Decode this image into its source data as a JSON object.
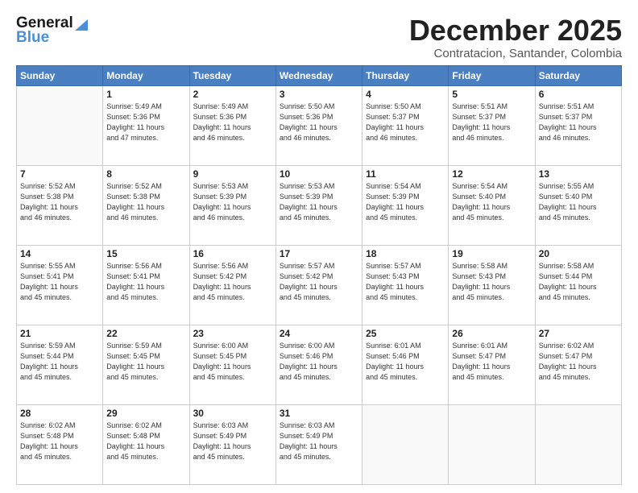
{
  "header": {
    "logo_line1": "General",
    "logo_line2": "Blue",
    "month": "December 2025",
    "location": "Contratacion, Santander, Colombia"
  },
  "weekdays": [
    "Sunday",
    "Monday",
    "Tuesday",
    "Wednesday",
    "Thursday",
    "Friday",
    "Saturday"
  ],
  "weeks": [
    [
      {
        "day": "",
        "info": ""
      },
      {
        "day": "1",
        "info": "Sunrise: 5:49 AM\nSunset: 5:36 PM\nDaylight: 11 hours\nand 47 minutes."
      },
      {
        "day": "2",
        "info": "Sunrise: 5:49 AM\nSunset: 5:36 PM\nDaylight: 11 hours\nand 46 minutes."
      },
      {
        "day": "3",
        "info": "Sunrise: 5:50 AM\nSunset: 5:36 PM\nDaylight: 11 hours\nand 46 minutes."
      },
      {
        "day": "4",
        "info": "Sunrise: 5:50 AM\nSunset: 5:37 PM\nDaylight: 11 hours\nand 46 minutes."
      },
      {
        "day": "5",
        "info": "Sunrise: 5:51 AM\nSunset: 5:37 PM\nDaylight: 11 hours\nand 46 minutes."
      },
      {
        "day": "6",
        "info": "Sunrise: 5:51 AM\nSunset: 5:37 PM\nDaylight: 11 hours\nand 46 minutes."
      }
    ],
    [
      {
        "day": "7",
        "info": "Sunrise: 5:52 AM\nSunset: 5:38 PM\nDaylight: 11 hours\nand 46 minutes."
      },
      {
        "day": "8",
        "info": "Sunrise: 5:52 AM\nSunset: 5:38 PM\nDaylight: 11 hours\nand 46 minutes."
      },
      {
        "day": "9",
        "info": "Sunrise: 5:53 AM\nSunset: 5:39 PM\nDaylight: 11 hours\nand 46 minutes."
      },
      {
        "day": "10",
        "info": "Sunrise: 5:53 AM\nSunset: 5:39 PM\nDaylight: 11 hours\nand 45 minutes."
      },
      {
        "day": "11",
        "info": "Sunrise: 5:54 AM\nSunset: 5:39 PM\nDaylight: 11 hours\nand 45 minutes."
      },
      {
        "day": "12",
        "info": "Sunrise: 5:54 AM\nSunset: 5:40 PM\nDaylight: 11 hours\nand 45 minutes."
      },
      {
        "day": "13",
        "info": "Sunrise: 5:55 AM\nSunset: 5:40 PM\nDaylight: 11 hours\nand 45 minutes."
      }
    ],
    [
      {
        "day": "14",
        "info": "Sunrise: 5:55 AM\nSunset: 5:41 PM\nDaylight: 11 hours\nand 45 minutes."
      },
      {
        "day": "15",
        "info": "Sunrise: 5:56 AM\nSunset: 5:41 PM\nDaylight: 11 hours\nand 45 minutes."
      },
      {
        "day": "16",
        "info": "Sunrise: 5:56 AM\nSunset: 5:42 PM\nDaylight: 11 hours\nand 45 minutes."
      },
      {
        "day": "17",
        "info": "Sunrise: 5:57 AM\nSunset: 5:42 PM\nDaylight: 11 hours\nand 45 minutes."
      },
      {
        "day": "18",
        "info": "Sunrise: 5:57 AM\nSunset: 5:43 PM\nDaylight: 11 hours\nand 45 minutes."
      },
      {
        "day": "19",
        "info": "Sunrise: 5:58 AM\nSunset: 5:43 PM\nDaylight: 11 hours\nand 45 minutes."
      },
      {
        "day": "20",
        "info": "Sunrise: 5:58 AM\nSunset: 5:44 PM\nDaylight: 11 hours\nand 45 minutes."
      }
    ],
    [
      {
        "day": "21",
        "info": "Sunrise: 5:59 AM\nSunset: 5:44 PM\nDaylight: 11 hours\nand 45 minutes."
      },
      {
        "day": "22",
        "info": "Sunrise: 5:59 AM\nSunset: 5:45 PM\nDaylight: 11 hours\nand 45 minutes."
      },
      {
        "day": "23",
        "info": "Sunrise: 6:00 AM\nSunset: 5:45 PM\nDaylight: 11 hours\nand 45 minutes."
      },
      {
        "day": "24",
        "info": "Sunrise: 6:00 AM\nSunset: 5:46 PM\nDaylight: 11 hours\nand 45 minutes."
      },
      {
        "day": "25",
        "info": "Sunrise: 6:01 AM\nSunset: 5:46 PM\nDaylight: 11 hours\nand 45 minutes."
      },
      {
        "day": "26",
        "info": "Sunrise: 6:01 AM\nSunset: 5:47 PM\nDaylight: 11 hours\nand 45 minutes."
      },
      {
        "day": "27",
        "info": "Sunrise: 6:02 AM\nSunset: 5:47 PM\nDaylight: 11 hours\nand 45 minutes."
      }
    ],
    [
      {
        "day": "28",
        "info": "Sunrise: 6:02 AM\nSunset: 5:48 PM\nDaylight: 11 hours\nand 45 minutes."
      },
      {
        "day": "29",
        "info": "Sunrise: 6:02 AM\nSunset: 5:48 PM\nDaylight: 11 hours\nand 45 minutes."
      },
      {
        "day": "30",
        "info": "Sunrise: 6:03 AM\nSunset: 5:49 PM\nDaylight: 11 hours\nand 45 minutes."
      },
      {
        "day": "31",
        "info": "Sunrise: 6:03 AM\nSunset: 5:49 PM\nDaylight: 11 hours\nand 45 minutes."
      },
      {
        "day": "",
        "info": ""
      },
      {
        "day": "",
        "info": ""
      },
      {
        "day": "",
        "info": ""
      }
    ]
  ]
}
